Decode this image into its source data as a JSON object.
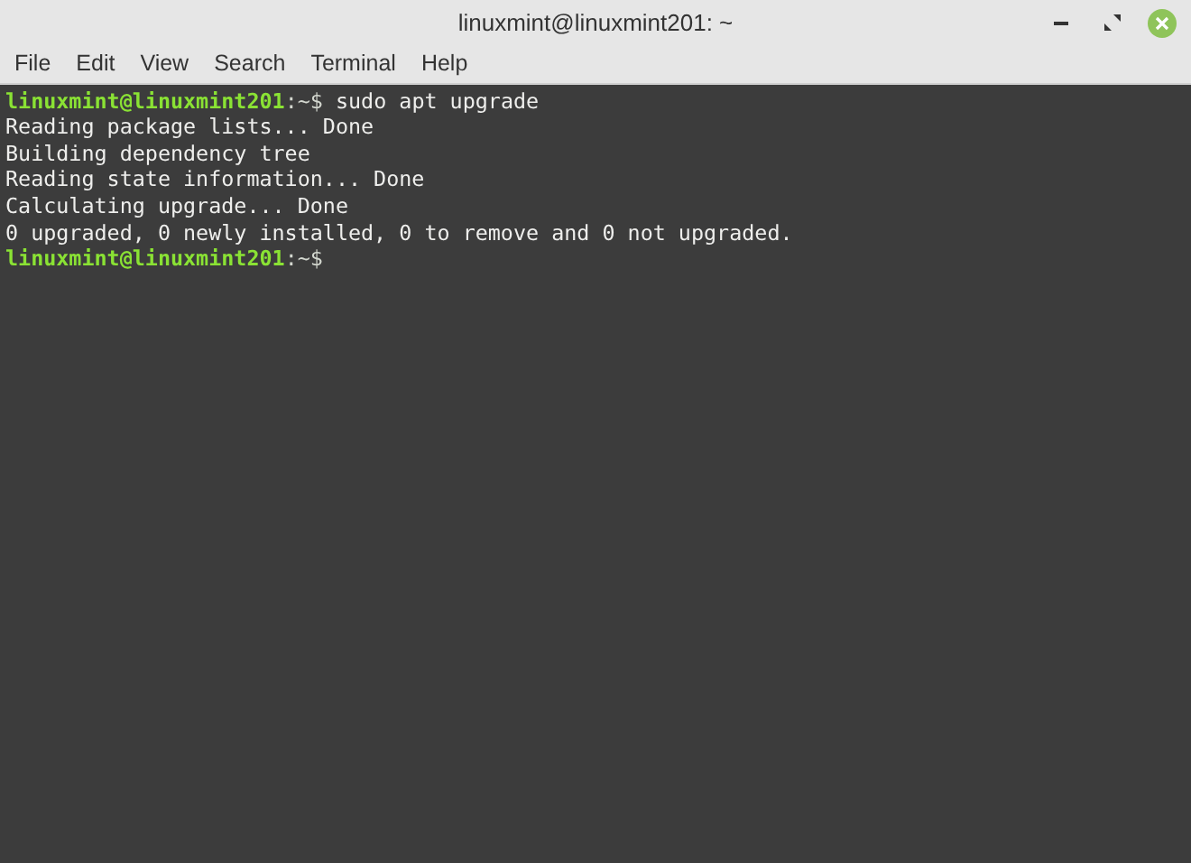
{
  "window": {
    "title": "linuxmint@linuxmint201: ~"
  },
  "menu": [
    "File",
    "Edit",
    "View",
    "Search",
    "Terminal",
    "Help"
  ],
  "lines": [
    {
      "kind": "prompt",
      "user": "linuxmint@linuxmint201",
      "path": ":~$",
      "command": "sudo apt upgrade"
    },
    {
      "kind": "output",
      "text": "Reading package lists... Done"
    },
    {
      "kind": "output",
      "text": "Building dependency tree"
    },
    {
      "kind": "output",
      "text": "Reading state information... Done"
    },
    {
      "kind": "output",
      "text": "Calculating upgrade... Done"
    },
    {
      "kind": "output",
      "text": "0 upgraded, 0 newly installed, 0 to remove and 0 not upgraded."
    },
    {
      "kind": "prompt",
      "user": "linuxmint@linuxmint201",
      "path": ":~$"
    }
  ]
}
